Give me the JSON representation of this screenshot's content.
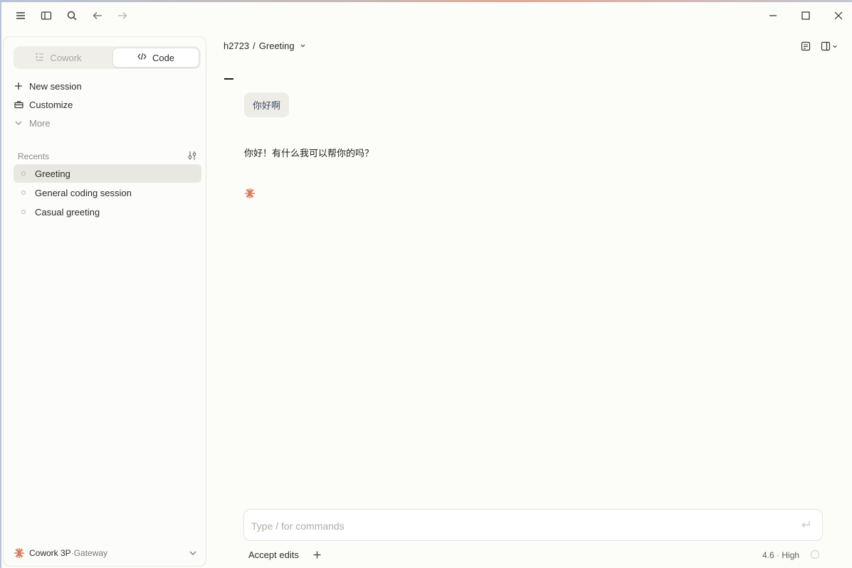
{
  "titlebar": {
    "icons": [
      "menu-icon",
      "sidebar-toggle-icon",
      "search-icon",
      "back-arrow-icon",
      "forward-arrow-icon",
      "minimize-icon",
      "maximize-icon",
      "close-icon"
    ]
  },
  "sidebar": {
    "modes": [
      {
        "label": "Cowork",
        "icon": "checklist-icon",
        "active": false
      },
      {
        "label": "Code",
        "icon": "code-icon",
        "active": true
      }
    ],
    "nav": [
      {
        "label": "New session",
        "icon": "plus-icon"
      },
      {
        "label": "Customize",
        "icon": "briefcase-icon"
      },
      {
        "label": "More",
        "icon": "chevron-down-icon"
      }
    ],
    "recents_title": "Recents",
    "recents": [
      {
        "label": "Greeting",
        "active": true
      },
      {
        "label": "General coding session",
        "active": false
      },
      {
        "label": "Casual greeting",
        "active": false
      }
    ],
    "footer": {
      "name": "Cowork 3P",
      "separator": " · ",
      "sub": "Gateway"
    }
  },
  "header": {
    "project": "h2723",
    "separator": "/",
    "session": "Greeting"
  },
  "chat": {
    "user_message": "你好啊",
    "assistant_message": "你好！有什么我可以帮你的吗？"
  },
  "composer": {
    "placeholder": "Type / for commands",
    "value": "",
    "accept_edits": "Accept edits",
    "model_version": "4.6",
    "model_sep": " · ",
    "effort": "High"
  },
  "colors": {
    "accent_spark": "#d97757",
    "background": "#fcfcf9",
    "active_item": "#e9e7e1"
  }
}
